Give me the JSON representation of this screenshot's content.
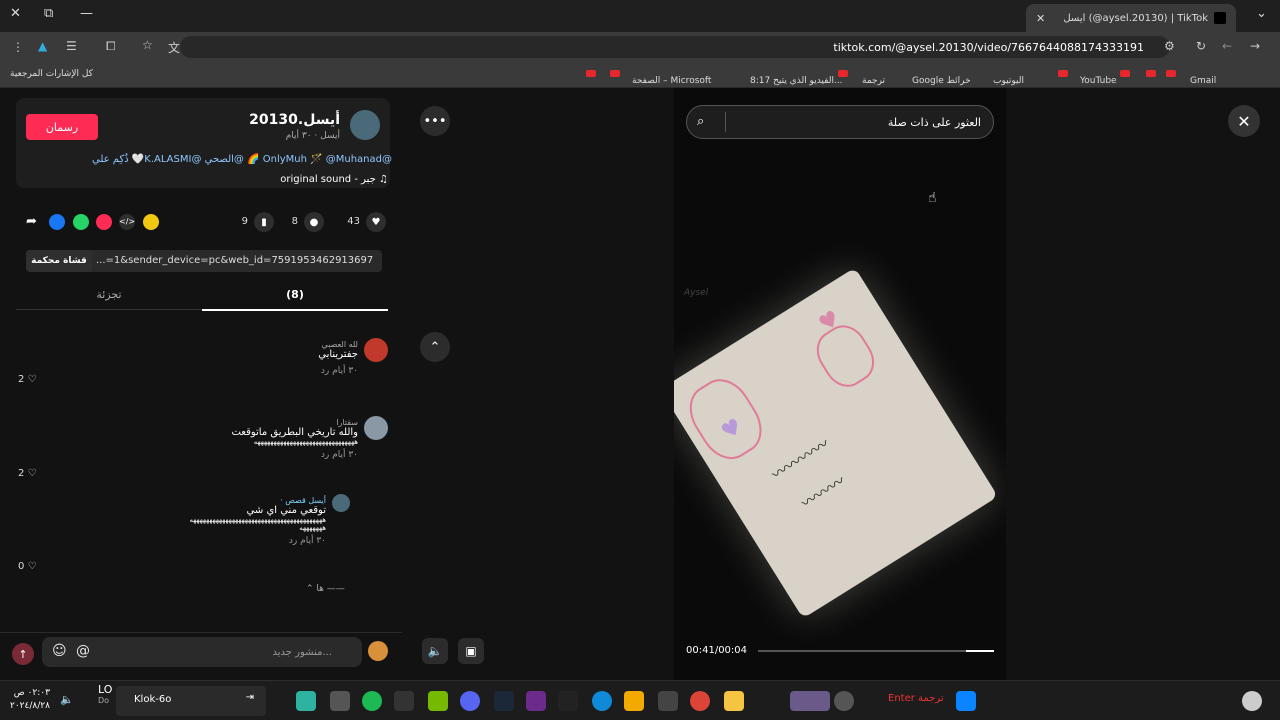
{
  "browser": {
    "tab_title": "أيسل (@aysel.20130) | TikTok",
    "url": "tiktok.com/@aysel.20130/video/7667644088174333191",
    "bookmarks": [
      "Gmail",
      "YouTube",
      "اليوتيوب",
      "Google خرائط",
      "ترجمة",
      "8:17 الفيديو الذي يتيح...",
      "الصفحة – Microsoft"
    ],
    "all_bookmarks": "كل الإشارات المرجعية"
  },
  "post": {
    "username": "أيسل.20130",
    "subtitle": "أيسل · ٣٠ أيام",
    "follow_label": "رسمان",
    "description": "@OnlyMuh 🪄 @Muhanad 🌈 @الصحي @K.ALASMI🤍 ذُكِم علي",
    "sound": "original sound - جبر",
    "likes": "43",
    "comments": "8",
    "saves": "9",
    "link": "...=1&sender_device=pc&web_id=7591953462913697336",
    "copy_label": "قشاة محكمة",
    "tab_comments": "(8)",
    "tab_other": "تجزئة"
  },
  "comments": [
    {
      "name": "لله العصبي",
      "text": "جفترينابي",
      "meta": "٣٠ أيام   رد",
      "likes": "2"
    },
    {
      "name": "سقتارا",
      "text": "والله تاريخي البطريق ماتوقعت",
      "extra": "هههههههههههههههههههههههههههههههه",
      "meta": "٣٠ أيام   رد",
      "likes": "2"
    },
    {
      "name": "أيسل قصص ·",
      "text": "توقعي مني اي شي",
      "extra": "هههههههههههههههههههههههههههههههههههههههههه",
      "extra2": "هههههههه",
      "meta": "٣٠ أيام   رد",
      "likes": "0"
    }
  ],
  "more_replies": "ها",
  "reply_placeholder": "منشور جديد...",
  "video": {
    "search_query": "العثور على ذات صلة",
    "time": "00:41/00:04",
    "progress": 0.12,
    "watermark": "Aysel"
  },
  "taskbar": {
    "time": "٠٢:٠٣ ص",
    "date": "٢٠٢٤/٨/٢٨",
    "media_title": "LO",
    "media_sub": "Do",
    "k_label": "Klok-6o",
    "enter_label": "Enter ترجمة"
  },
  "colors": {
    "accent": "#fe2c55",
    "link": "#8fc7ff"
  }
}
